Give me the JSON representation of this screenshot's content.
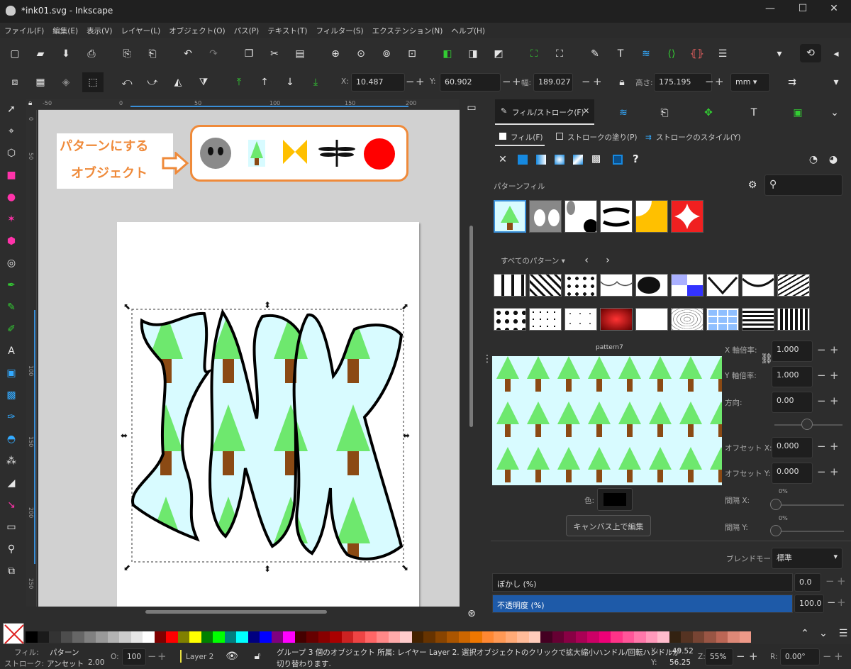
{
  "window": {
    "title": "*ink01.svg - Inkscape",
    "controls": [
      "—",
      "☐",
      "✕"
    ]
  },
  "menu": [
    "ファイル(F)",
    "編集(E)",
    "表示(V)",
    "レイヤー(L)",
    "オブジェクト(O)",
    "パス(P)",
    "テキスト(T)",
    "フィルター(S)",
    "エクステンション(N)",
    "ヘルプ(H)"
  ],
  "toolbar2": {
    "x_label": "X:",
    "x": "10.487",
    "y_label": "Y:",
    "y": "60.902",
    "w_label": "幅:",
    "w": "189.027",
    "h_label": "高さ:",
    "h": "175.195",
    "unit": "mm"
  },
  "ruler": {
    "h": [
      "-50",
      "0",
      "50",
      "100",
      "150",
      "200"
    ],
    "v": [
      "0",
      "50",
      "100",
      "150",
      "200",
      "250"
    ]
  },
  "canvas": {
    "callout_line1": "パターンにする",
    "callout_line2": "オブジェクト",
    "art_text": "INK"
  },
  "panel": {
    "tabs": [
      "フィル/ストローク(F)"
    ],
    "subtabs": [
      "フィル(F)",
      "ストロークの塗り(P)",
      "ストロークのスタイル(Y)"
    ],
    "pattern_fill_label": "パターンフィル",
    "all_patterns": "すべてのパターン",
    "pattern_name": "pattern7",
    "x_scale_label": "X 軸倍率:",
    "x_scale": "1.000",
    "y_scale_label": "Y 軸倍率:",
    "y_scale": "1.000",
    "orientation_label": "方向:",
    "orientation": "0.00",
    "offset_x_label": "オフセット X:",
    "offset_x": "0.000",
    "offset_y_label": "オフセット Y:",
    "offset_y": "0.000",
    "color_label": "色:",
    "gap_x_label": "間隔 X:",
    "gap_y_label": "間隔 Y:",
    "gap_pct": "0%",
    "edit_button": "キャンバス上で編集",
    "blend_label": "ブレンドモード:",
    "blend": "標準",
    "blur_label": "ぼかし (%)",
    "blur": "0.0",
    "opacity_label": "不透明度 (%)",
    "opacity": "100.0",
    "question": "?"
  },
  "status": {
    "fill_label": "フィル:",
    "fill_val": "パターン",
    "stroke_label": "ストローク:",
    "stroke_val": "アンセット",
    "stroke_width": "2.00",
    "o_label": "O:",
    "o_val": "100",
    "layer": "Layer 2",
    "message1": "グループ 3 個のオブジェクト 所属: レイヤー Layer 2. 選択オブジェクトのクリックで拡大縮小ハンドル/回転ハンドルが",
    "message2": "切り替わります.",
    "x_label": "X:",
    "x": "-49.52",
    "y_label": "Y:",
    "y": "56.25",
    "zoom_label": "Z:",
    "zoom": "55%",
    "r_label": "R:",
    "rotation": "0.00°"
  },
  "colors": {
    "accent": "#1e5aa8",
    "orange": "#ef8a3a",
    "treeGreen": "#6ee86e",
    "trunk": "#8b4a14",
    "sky": "#d8fbff"
  }
}
